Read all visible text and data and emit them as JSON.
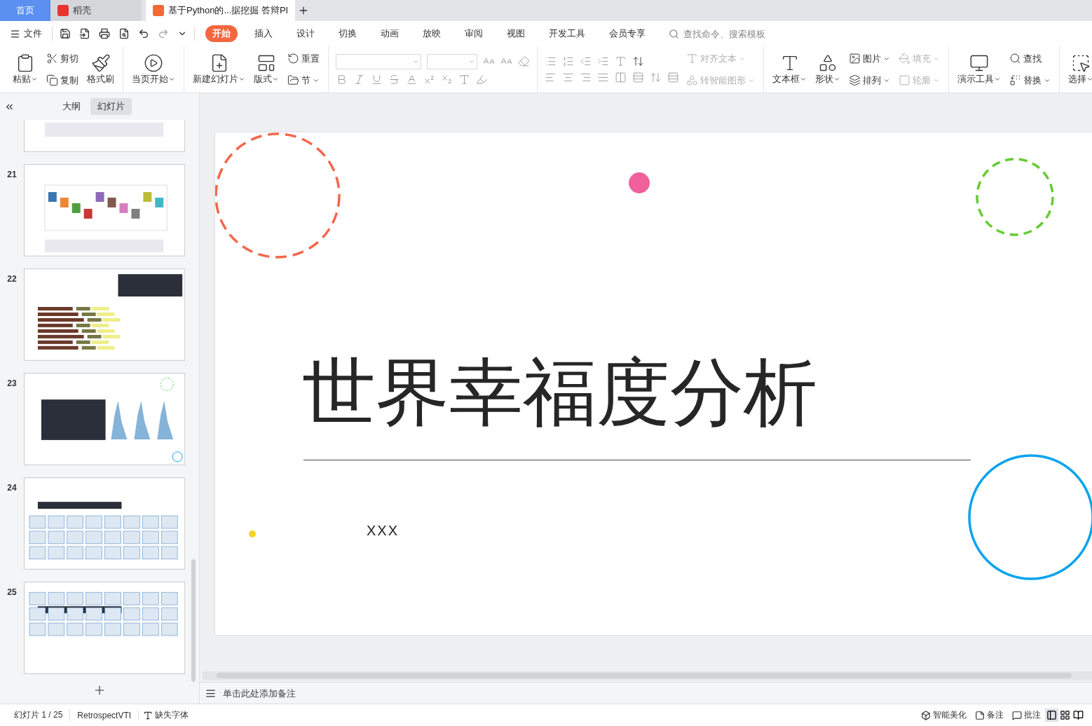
{
  "tabs": [
    {
      "label": "首页",
      "kind": "home"
    },
    {
      "label": "稻壳",
      "kind": "app"
    },
    {
      "label": "基于Python的...据挖掘 答辩PI",
      "kind": "doc"
    }
  ],
  "menu": {
    "file_label": "文件",
    "ribbon_tabs": [
      {
        "label": "开始",
        "selected": true
      },
      {
        "label": "插入",
        "selected": false
      },
      {
        "label": "设计",
        "selected": false
      },
      {
        "label": "切换",
        "selected": false
      },
      {
        "label": "动画",
        "selected": false
      },
      {
        "label": "放映",
        "selected": false
      },
      {
        "label": "审阅",
        "selected": false
      },
      {
        "label": "视图",
        "selected": false
      },
      {
        "label": "开发工具",
        "selected": false
      },
      {
        "label": "会员专享",
        "selected": false
      }
    ],
    "search": {
      "placeholder": "查找命令、搜索模板"
    }
  },
  "ribbon": {
    "groups": [
      {
        "kind": "items",
        "columns": [
          {
            "items": [
              {
                "label": "粘贴",
                "kind": "large",
                "dropdown": true,
                "disabled": false
              }
            ]
          },
          {
            "items": [
              {
                "label": "剪切",
                "kind": "small",
                "dropdown": false,
                "disabled": false
              },
              {
                "label": "复制",
                "kind": "small",
                "dropdown": false,
                "disabled": false
              }
            ]
          },
          {
            "items": [
              {
                "label": "格式刷",
                "kind": "large",
                "dropdown": false,
                "disabled": false
              }
            ]
          }
        ]
      },
      {
        "kind": "items",
        "columns": [
          {
            "items": [
              {
                "label": "当页开始",
                "kind": "large",
                "dropdown": true,
                "disabled": false
              }
            ]
          }
        ]
      },
      {
        "kind": "items",
        "columns": [
          {
            "items": [
              {
                "label": "新建幻灯片",
                "kind": "large",
                "dropdown": true,
                "disabled": false
              }
            ]
          },
          {
            "items": [
              {
                "label": "版式",
                "kind": "large",
                "dropdown": true,
                "disabled": false
              }
            ]
          },
          {
            "items": [
              {
                "label": "重置",
                "kind": "small",
                "dropdown": false,
                "disabled": false
              },
              {
                "label": "节",
                "kind": "small",
                "dropdown": true,
                "disabled": false
              }
            ]
          }
        ]
      },
      {
        "kind": "font"
      },
      {
        "kind": "paragraph",
        "columns": [
          {
            "items": [
              {
                "label": "对齐文本",
                "kind": "small",
                "dropdown": true,
                "disabled": true
              },
              {
                "label": "转智能图形",
                "kind": "small",
                "dropdown": true,
                "disabled": true
              }
            ]
          }
        ]
      },
      {
        "kind": "items",
        "columns": [
          {
            "items": [
              {
                "label": "文本框",
                "kind": "large",
                "dropdown": true,
                "disabled": false
              }
            ]
          },
          {
            "items": [
              {
                "label": "形状",
                "kind": "large",
                "dropdown": true,
                "disabled": false
              }
            ]
          },
          {
            "items": [
              {
                "label": "图片",
                "kind": "small",
                "dropdown": true,
                "disabled": false
              },
              {
                "label": "排列",
                "kind": "small",
                "dropdown": true,
                "disabled": false
              }
            ]
          },
          {
            "items": [
              {
                "label": "填充",
                "kind": "small",
                "dropdown": true,
                "disabled": true
              },
              {
                "label": "轮廓",
                "kind": "small",
                "dropdown": true,
                "disabled": true
              }
            ]
          }
        ]
      },
      {
        "kind": "items",
        "columns": [
          {
            "items": [
              {
                "label": "演示工具",
                "kind": "large",
                "dropdown": true,
                "disabled": false
              }
            ]
          },
          {
            "items": [
              {
                "label": "查找",
                "kind": "small",
                "dropdown": false,
                "disabled": false
              },
              {
                "label": "替换",
                "kind": "small",
                "dropdown": true,
                "disabled": false
              }
            ]
          }
        ]
      },
      {
        "kind": "items",
        "columns": [
          {
            "items": [
              {
                "label": "选择",
                "kind": "large",
                "dropdown": true,
                "disabled": false
              }
            ]
          }
        ]
      }
    ]
  },
  "slide_panel": {
    "tabs": [
      {
        "label": "大纲",
        "selected": false
      },
      {
        "label": "幻灯片",
        "selected": true
      }
    ],
    "thumbnails": [
      {
        "kind": "picture"
      },
      {
        "number": "21",
        "kind": "picture"
      },
      {
        "number": "22",
        "kind": "picture"
      },
      {
        "number": "23",
        "kind": "picture"
      },
      {
        "number": "24",
        "kind": "picture"
      },
      {
        "number": "25",
        "kind": "picture"
      }
    ]
  },
  "slide": {
    "title": "世界幸福度分析",
    "subtitle": "XXX"
  },
  "notes": {
    "placeholder": "单击此处添加备注"
  },
  "status_bar": {
    "slide_count": "幻灯片 1 / 25",
    "theme": "RetrospectVTI",
    "missing_fonts": "缺失字体",
    "beautify": "智能美化",
    "notes": "备注",
    "comments": "批注"
  }
}
